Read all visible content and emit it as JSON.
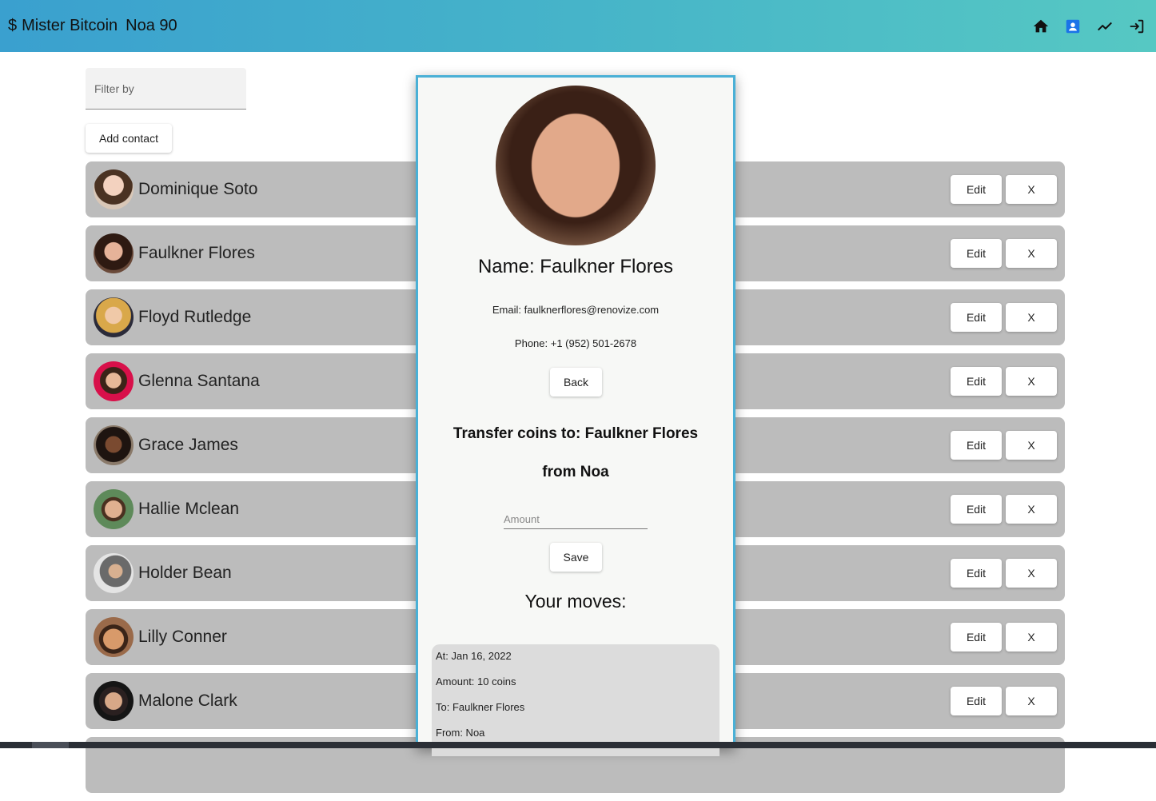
{
  "header": {
    "currency_symbol": "$",
    "app_title": "Mister Bitcoin",
    "user_label": "Noa 90",
    "nav": [
      "home-icon",
      "contacts-icon",
      "chart-icon",
      "logout-icon"
    ],
    "accent_colors": [
      "#3aa0cf",
      "#56c8c3"
    ],
    "active_nav_color": "#1a73e8"
  },
  "filter": {
    "placeholder": "Filter by"
  },
  "add_contact_label": "Add contact",
  "contacts": [
    {
      "name": "Dominique Soto",
      "edit": "Edit",
      "delete": "X"
    },
    {
      "name": "Faulkner Flores",
      "edit": "Edit",
      "delete": "X"
    },
    {
      "name": "Floyd Rutledge",
      "edit": "Edit",
      "delete": "X"
    },
    {
      "name": "Glenna Santana",
      "edit": "Edit",
      "delete": "X"
    },
    {
      "name": "Grace James",
      "edit": "Edit",
      "delete": "X"
    },
    {
      "name": "Hallie Mclean",
      "edit": "Edit",
      "delete": "X"
    },
    {
      "name": "Holder Bean",
      "edit": "Edit",
      "delete": "X"
    },
    {
      "name": "Lilly Conner",
      "edit": "Edit",
      "delete": "X"
    },
    {
      "name": "Malone Clark",
      "edit": "Edit",
      "delete": "X"
    }
  ],
  "details": {
    "name_line": "Name: Faulkner Flores",
    "email_line": "Email: faulknerflores@renovize.com",
    "phone_line": "Phone: +1 (952) 501-2678",
    "back_label": "Back",
    "transfer_title": "Transfer coins to: Faulkner Flores",
    "transfer_from": "from Noa",
    "amount_placeholder": "Amount",
    "save_label": "Save",
    "moves_title": "Your moves:",
    "moves": [
      {
        "at": "At: Jan 16, 2022",
        "amount": "Amount: 10 coins",
        "to": "To: Faulkner Flores",
        "from": "From: Noa"
      }
    ]
  }
}
